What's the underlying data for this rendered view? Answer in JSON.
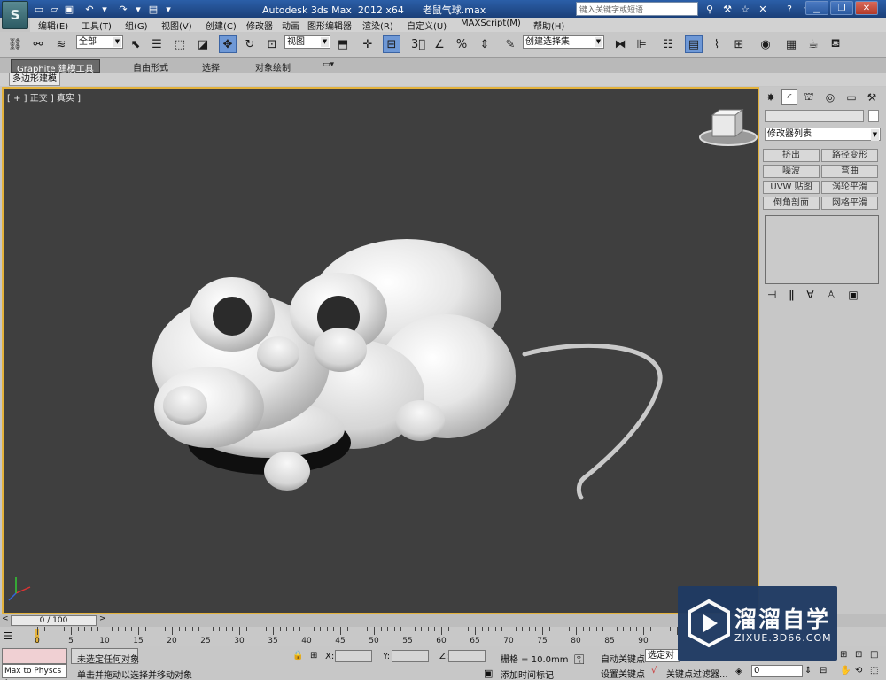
{
  "app": {
    "title_product": "Autodesk 3ds Max  2012 x64",
    "title_file": "老鼠气球.max",
    "logo_text": "S",
    "search_placeholder": "键入关键字或短语"
  },
  "menus": [
    "编辑(E)",
    "工具(T)",
    "组(G)",
    "视图(V)",
    "创建(C)",
    "修改器",
    "动画",
    "图形编辑器",
    "渲染(R)",
    "自定义(U)",
    "MAXScript(M)",
    "帮助(H)"
  ],
  "toolbar": {
    "selection_filter": "全部",
    "reference_coord": "视图",
    "named_selection": "创建选择集"
  },
  "ribbon": {
    "tabs": [
      "Graphite 建模工具",
      "自由形式",
      "选择",
      "对象绘制"
    ],
    "sub_tab": "多边形建模"
  },
  "viewport": {
    "label": "[ + ] 正交 ] 真实 ]"
  },
  "command_panel": {
    "modifier_list": "修改器列表",
    "buttons": [
      "挤出",
      "路径变形",
      "噪波",
      "弯曲",
      "UVW 贴图",
      "涡轮平滑",
      "倒角剖面",
      "网格平滑"
    ]
  },
  "timeline": {
    "frame_display": "0 / 100",
    "ticks": [
      "0",
      "5",
      "10",
      "15",
      "20",
      "25",
      "30",
      "35",
      "40",
      "45",
      "50",
      "55",
      "60",
      "65",
      "70",
      "75",
      "80",
      "85",
      "90"
    ]
  },
  "status": {
    "maxscript_listener": "Max to Physcs (",
    "selection_status": "未选定任何对象",
    "prompt": "单击并拖动以选择并移动对象",
    "x_label": "X:",
    "y_label": "Y:",
    "z_label": "Z:",
    "grid": "栅格 = 10.0mm",
    "add_time_tag": "添加时间标记",
    "auto_key": "自动关键点",
    "selected_objects": "选定对象",
    "set_key": "设置关键点",
    "key_filters": "关键点过滤器...",
    "current_frame": "0"
  },
  "watermark": {
    "name": "溜溜自学",
    "url": "ZIXUE.3D66.COM"
  }
}
